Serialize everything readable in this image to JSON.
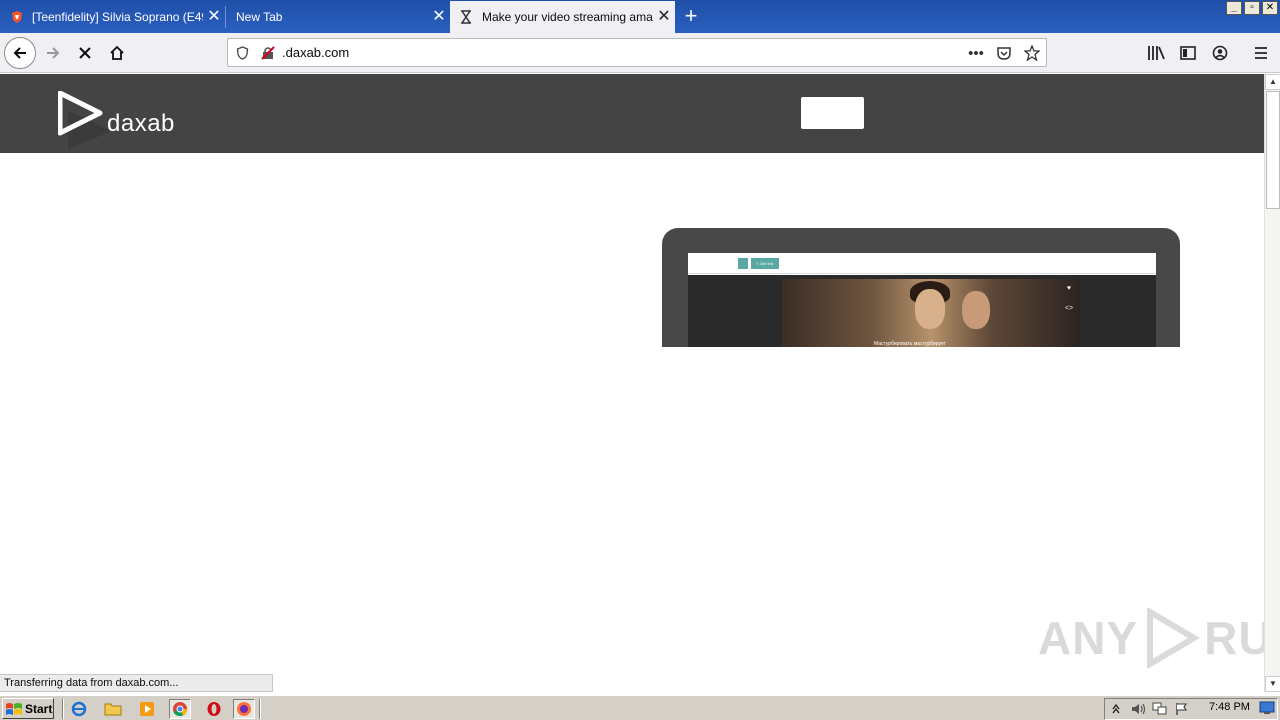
{
  "browser": {
    "tabs": [
      {
        "title": "[Teenfidelity] Silvia Soprano (E49",
        "icon": "brave-shield-icon",
        "active": false
      },
      {
        "title": "New Tab",
        "icon": "",
        "active": false
      },
      {
        "title": "Make your video streaming amazin",
        "icon": "hourglass-icon",
        "active": true
      }
    ],
    "new_tab_label": "+",
    "window_controls": {
      "minimize": "_",
      "restore": "▫",
      "close": "✕"
    },
    "url": ".daxab.com",
    "status_text": "Transferring data from daxab.com..."
  },
  "site": {
    "brand": "daxab",
    "header_color": "#444444",
    "mockup_buttons": {
      "small": "",
      "wide": "≡ Get link"
    },
    "video_caption": "Мастурбировать мастурбирует"
  },
  "watermark": {
    "text_left": "ANY",
    "text_right": "RUN"
  },
  "taskbar": {
    "start_label": "Start",
    "quick_launch": [
      "ie-icon",
      "folder-icon",
      "media-player-icon",
      "chrome-icon",
      "opera-icon",
      "firefox-icon"
    ],
    "tray_icons": [
      "tray-arrow-icon",
      "volume-icon",
      "network-icon",
      "flag-icon"
    ],
    "clock": "7:48 PM"
  }
}
